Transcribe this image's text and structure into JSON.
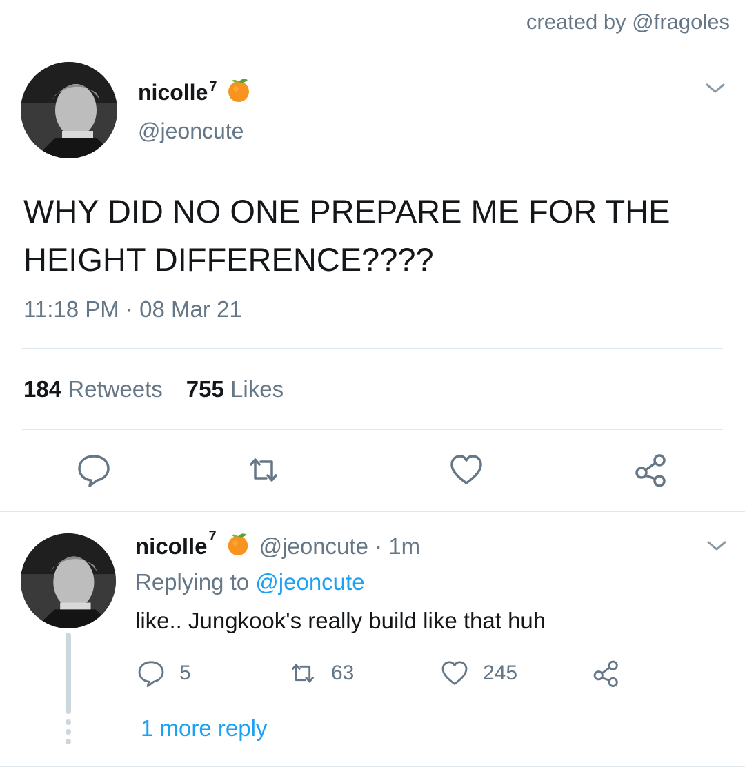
{
  "credit": "created by @fragoles",
  "tweet": {
    "display_name": "nicolle",
    "name_sup": "7",
    "emoji_icon": "tangerine-icon",
    "handle": "@jeoncute",
    "text": "WHY DID NO ONE PREPARE ME FOR THE HEIGHT DIFFERENCE????",
    "timestamp": "11:18 PM · 08 Mar 21",
    "retweets_count": "184",
    "retweets_label": "Retweets",
    "likes_count": "755",
    "likes_label": "Likes"
  },
  "reply": {
    "display_name": "nicolle",
    "name_sup": "7",
    "handle_time": "@jeoncute · 1m",
    "replying_prefix": "Replying to",
    "replying_to": "@jeoncute",
    "text": "like.. Jungkook's really build like that huh",
    "reply_count": "5",
    "retweet_count": "63",
    "like_count": "245",
    "more_replies": "1 more reply"
  },
  "colors": {
    "text": "#14171a",
    "secondary": "#657786",
    "link": "#1da1f2",
    "divider": "#e1e8ed"
  }
}
